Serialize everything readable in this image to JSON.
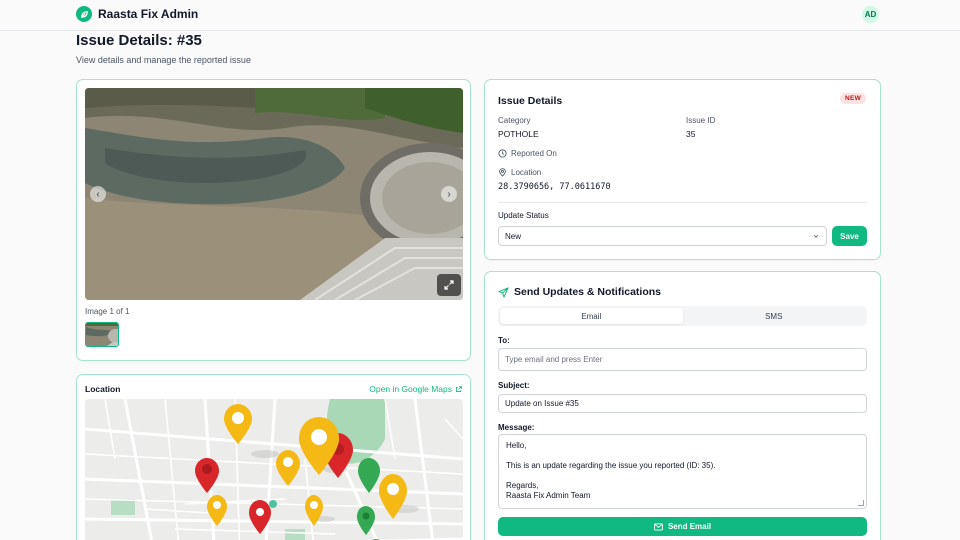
{
  "app": {
    "name": "Raasta Fix Admin",
    "user_initials": "AD",
    "accent": "#10b981"
  },
  "page": {
    "title": "Issue Details: #35",
    "subtitle": "View details and manage the reported issue"
  },
  "gallery": {
    "counter": "Image 1 of 1"
  },
  "location": {
    "title": "Location",
    "link_text": "Open in Google Maps"
  },
  "details": {
    "title": "Issue Details",
    "badge": "NEW",
    "category_label": "Category",
    "category_value": "POTHOLE",
    "id_label": "Issue ID",
    "id_value": "35",
    "reported_label": "Reported On",
    "location_label": "Location",
    "location_value": "28.3790656, 77.0611670",
    "status_label": "Update Status",
    "status_value": "New",
    "save_label": "Save"
  },
  "notify": {
    "title": "Send Updates & Notifications",
    "tabs": [
      {
        "label": "Email"
      },
      {
        "label": "SMS"
      }
    ],
    "to_label": "To:",
    "to_placeholder": "Type email and press Enter",
    "subject_label": "Subject:",
    "subject_value": "Update on Issue #35",
    "message_label": "Message:",
    "message_lines": [
      "Hello,",
      "",
      "This is an update regarding the issue you reported (ID: 35).",
      "",
      "Regards,",
      "Raasta Fix Admin Team"
    ],
    "send_label": "Send Email"
  },
  "icons": {
    "brand": "leaf-icon",
    "clock": "clock-icon",
    "pin": "map-pin-icon",
    "send": "send-icon",
    "mail": "mail-icon",
    "external": "external-link-icon",
    "expand": "expand-icon",
    "chevron": "chevron-down-icon"
  },
  "colors": {
    "badge_bg": "#fee2e2",
    "badge_text": "#b91c1c",
    "card_border": "#a7e3cf"
  }
}
